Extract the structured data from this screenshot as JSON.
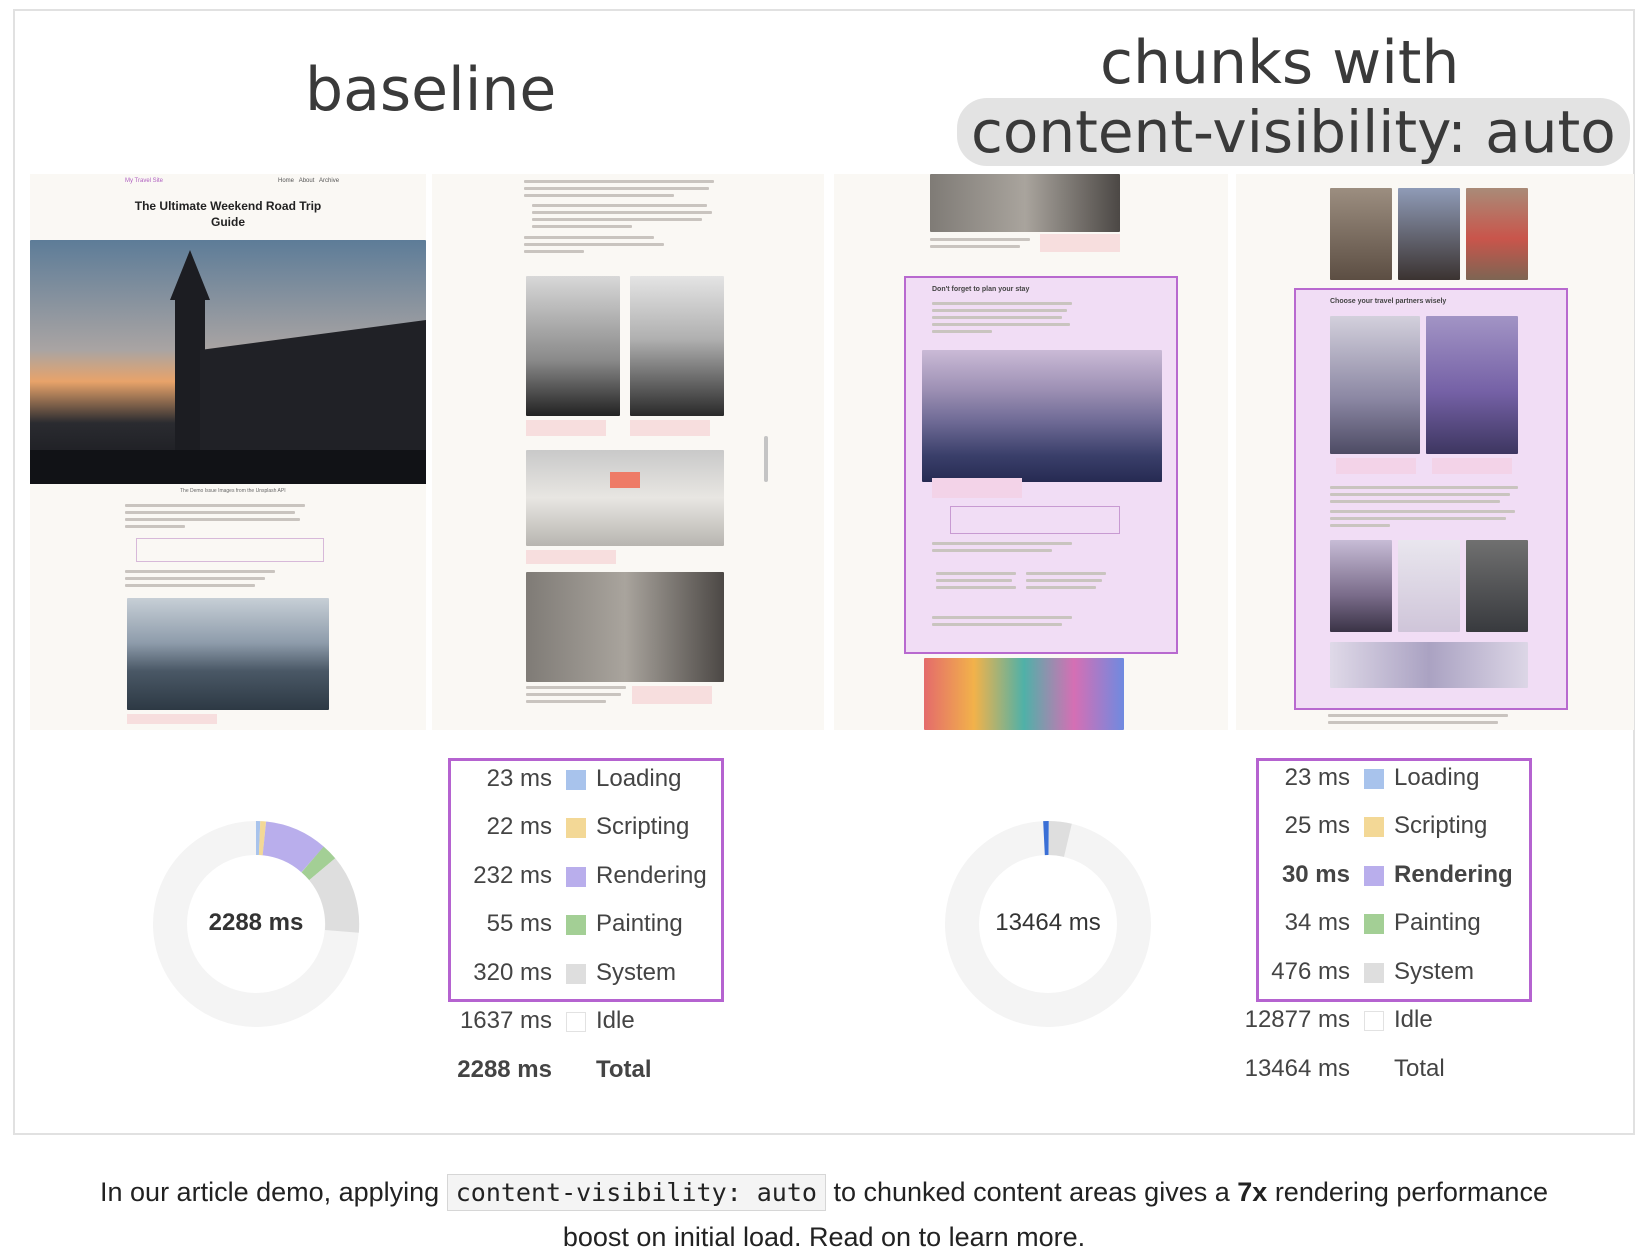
{
  "headings": {
    "baseline": "baseline",
    "chunks_line1": "chunks with",
    "chunks_line2": "content-visibility: auto"
  },
  "demo_page": {
    "site_name": "My Travel Site",
    "nav": [
      "Home",
      "About",
      "Archive"
    ],
    "title_line1": "The Ultimate Weekend Road Trip",
    "title_line2": "Guide",
    "hero_caption": "The Demo Issue Images from the Unsplash API",
    "section_plan": "Don't forget to plan your stay",
    "section_partners": "Choose your travel partners wisely"
  },
  "baseline": {
    "total_label": "2288 ms",
    "rows": [
      {
        "ms": "23 ms",
        "name": "Loading",
        "color": "#a8c3ec"
      },
      {
        "ms": "22 ms",
        "name": "Scripting",
        "color": "#f3d896"
      },
      {
        "ms": "232 ms",
        "name": "Rendering",
        "color": "#b9aeec"
      },
      {
        "ms": "55 ms",
        "name": "Painting",
        "color": "#a3cf95"
      },
      {
        "ms": "320 ms",
        "name": "System",
        "color": "#dedede"
      },
      {
        "ms": "1637 ms",
        "name": "Idle",
        "color": "#ffffff"
      },
      {
        "ms": "2288 ms",
        "name": "Total",
        "color": ""
      }
    ]
  },
  "chunked": {
    "total_label": "13464 ms",
    "rows": [
      {
        "ms": "23 ms",
        "name": "Loading",
        "color": "#a8c3ec"
      },
      {
        "ms": "25 ms",
        "name": "Scripting",
        "color": "#f3d896"
      },
      {
        "ms": "30 ms",
        "name": "Rendering",
        "color": "#b9aeec"
      },
      {
        "ms": "34 ms",
        "name": "Painting",
        "color": "#a3cf95"
      },
      {
        "ms": "476 ms",
        "name": "System",
        "color": "#dedede"
      },
      {
        "ms": "12877 ms",
        "name": "Idle",
        "color": "#ffffff"
      },
      {
        "ms": "13464 ms",
        "name": "Total",
        "color": ""
      }
    ]
  },
  "caption": {
    "before": "In our article demo, applying",
    "code": "content-visibility: auto",
    "middle": "to chunked content areas gives a",
    "bold": "7x",
    "after": "rendering performance",
    "line2": "boost on initial load. Read on to learn more."
  }
}
